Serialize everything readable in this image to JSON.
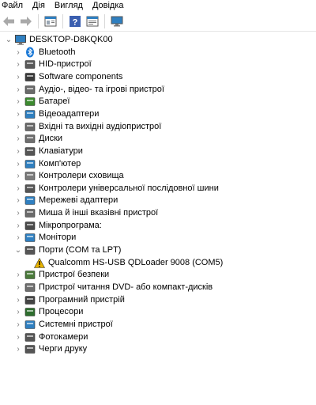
{
  "menu": [
    "Файл",
    "Дія",
    "Вигляд",
    "Довідка"
  ],
  "tree": {
    "root": "DESKTOP-D8KQK00",
    "categories": [
      {
        "label": "Bluetooth",
        "icon": "bluetooth-icon",
        "color": "#1877d6"
      },
      {
        "label": "HID-пристрої",
        "icon": "hid-icon",
        "color": "#5a5a5a"
      },
      {
        "label": "Software components",
        "icon": "software-component-icon",
        "color": "#3a3a3a"
      },
      {
        "label": "Аудіо-, відео- та ігрові пристрої",
        "icon": "audio-video-icon",
        "color": "#6a6a6a"
      },
      {
        "label": "Батареї",
        "icon": "battery-icon",
        "color": "#3c8a2f"
      },
      {
        "label": "Відеоадаптери",
        "icon": "display-adapter-icon",
        "color": "#2f7fc0"
      },
      {
        "label": "Вхідні та вихідні аудіопристрої",
        "icon": "audio-io-icon",
        "color": "#6a6a6a"
      },
      {
        "label": "Диски",
        "icon": "disk-icon",
        "color": "#6e6e6e"
      },
      {
        "label": "Клавіатури",
        "icon": "keyboard-icon",
        "color": "#555555"
      },
      {
        "label": "Комп'ютер",
        "icon": "computer-icon",
        "color": "#2f7fc0"
      },
      {
        "label": "Контролери сховища",
        "icon": "storage-controller-icon",
        "color": "#7a7a7a"
      },
      {
        "label": "Контролери універсальної послідовної шини",
        "icon": "usb-icon",
        "color": "#555555"
      },
      {
        "label": "Мережеві адаптери",
        "icon": "network-adapter-icon",
        "color": "#2f7fc0"
      },
      {
        "label": "Миша й інші вказівні пристрої",
        "icon": "mouse-icon",
        "color": "#6a6a6a"
      },
      {
        "label": "Мікропрограма:",
        "icon": "firmware-icon",
        "color": "#4a4a4a"
      },
      {
        "label": "Монітори",
        "icon": "monitor-icon",
        "color": "#2f7fc0"
      },
      {
        "label": "Порти (COM та LPT)",
        "icon": "port-icon",
        "color": "#555555",
        "expanded": true,
        "children": [
          {
            "label": "Qualcomm HS-USB QDLoader 9008 (COM5)",
            "icon": "warning-icon",
            "color": "#e8b400"
          }
        ]
      },
      {
        "label": "Пристрої безпеки",
        "icon": "security-device-icon",
        "color": "#4a7a3a"
      },
      {
        "label": "Пристрої читання DVD- або компакт-дисків",
        "icon": "dvd-icon",
        "color": "#6e6e6e"
      },
      {
        "label": "Програмний пристрій",
        "icon": "software-device-icon",
        "color": "#444444"
      },
      {
        "label": "Процесори",
        "icon": "processor-icon",
        "color": "#2e6e2e"
      },
      {
        "label": "Системні пристрої",
        "icon": "system-device-icon",
        "color": "#2f7fc0"
      },
      {
        "label": "Фотокамери",
        "icon": "camera-icon",
        "color": "#555555"
      },
      {
        "label": "Черги друку",
        "icon": "printer-icon",
        "color": "#555555"
      }
    ]
  },
  "accent": "#1877d6"
}
